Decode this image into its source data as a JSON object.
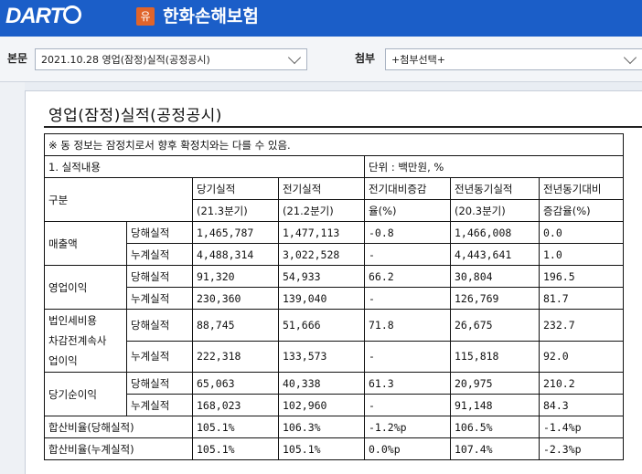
{
  "header": {
    "logo_text": "DART",
    "company_badge": "유",
    "company_name": "한화손해보험"
  },
  "toolbar": {
    "main_label": "본문",
    "main_select": "2021.10.28  영업(잠정)실적(공정공시)",
    "attach_label": "첨부",
    "attach_select": "+첨부선택+"
  },
  "document": {
    "title": "영업(잠정)실적(공정공시)",
    "notice": "※ 동 정보는 잠정치로서 향후 확정치와는 다를 수 있음.",
    "section": "1. 실적내용",
    "unit": "단위 : 백만원, %",
    "headers": {
      "category": "구분",
      "current": "당기실적",
      "current_period": "(21.3분기)",
      "previous": "전기실적",
      "previous_period": "(21.2분기)",
      "qoq_1": "전기대비증감",
      "qoq_2": "율(%)",
      "yoy": "전년동기실적",
      "yoy_period": "(20.3분기)",
      "yoy_rate_1": "전년동기대비",
      "yoy_rate_2": "증감율(%)"
    },
    "groups": [
      {
        "name": "매출액",
        "rows": [
          {
            "label": "당해실적",
            "cells": [
              "1,465,787",
              "1,477,113",
              "-0.8",
              "1,466,008",
              "0.0"
            ]
          },
          {
            "label": "누계실적",
            "cells": [
              "4,488,314",
              "3,022,528",
              "-",
              "4,443,641",
              "1.0"
            ]
          }
        ]
      },
      {
        "name": "영업이익",
        "rows": [
          {
            "label": "당해실적",
            "cells": [
              "91,320",
              "54,933",
              "66.2",
              "30,804",
              "196.5"
            ]
          },
          {
            "label": "누계실적",
            "cells": [
              "230,360",
              "139,040",
              "-",
              "126,769",
              "81.7"
            ]
          }
        ]
      },
      {
        "name_lines": [
          "법인세비용",
          "차감전계속사",
          "업이익"
        ],
        "rows": [
          {
            "label": "당해실적",
            "cells": [
              "88,745",
              "51,666",
              "71.8",
              "26,675",
              "232.7"
            ]
          },
          {
            "label": "누계실적",
            "cells": [
              "222,318",
              "133,573",
              "-",
              "115,818",
              "92.0"
            ]
          }
        ]
      },
      {
        "name": "당기순이익",
        "rows": [
          {
            "label": "당해실적",
            "cells": [
              "65,063",
              "40,338",
              "61.3",
              "20,975",
              "210.2"
            ]
          },
          {
            "label": "누계실적",
            "cells": [
              "168,023",
              "102,960",
              "-",
              "91,148",
              "84.3"
            ]
          }
        ]
      }
    ],
    "ratio_rows": [
      {
        "label": "합산비율(당해실적)",
        "cells": [
          "105.1%",
          "106.3%",
          "-1.2%p",
          "106.5%",
          "-1.4%p"
        ]
      },
      {
        "label": "합산비율(누계실적)",
        "cells": [
          "105.1%",
          "105.1%",
          "0.0%p",
          "107.4%",
          "-2.3%p"
        ]
      }
    ]
  }
}
